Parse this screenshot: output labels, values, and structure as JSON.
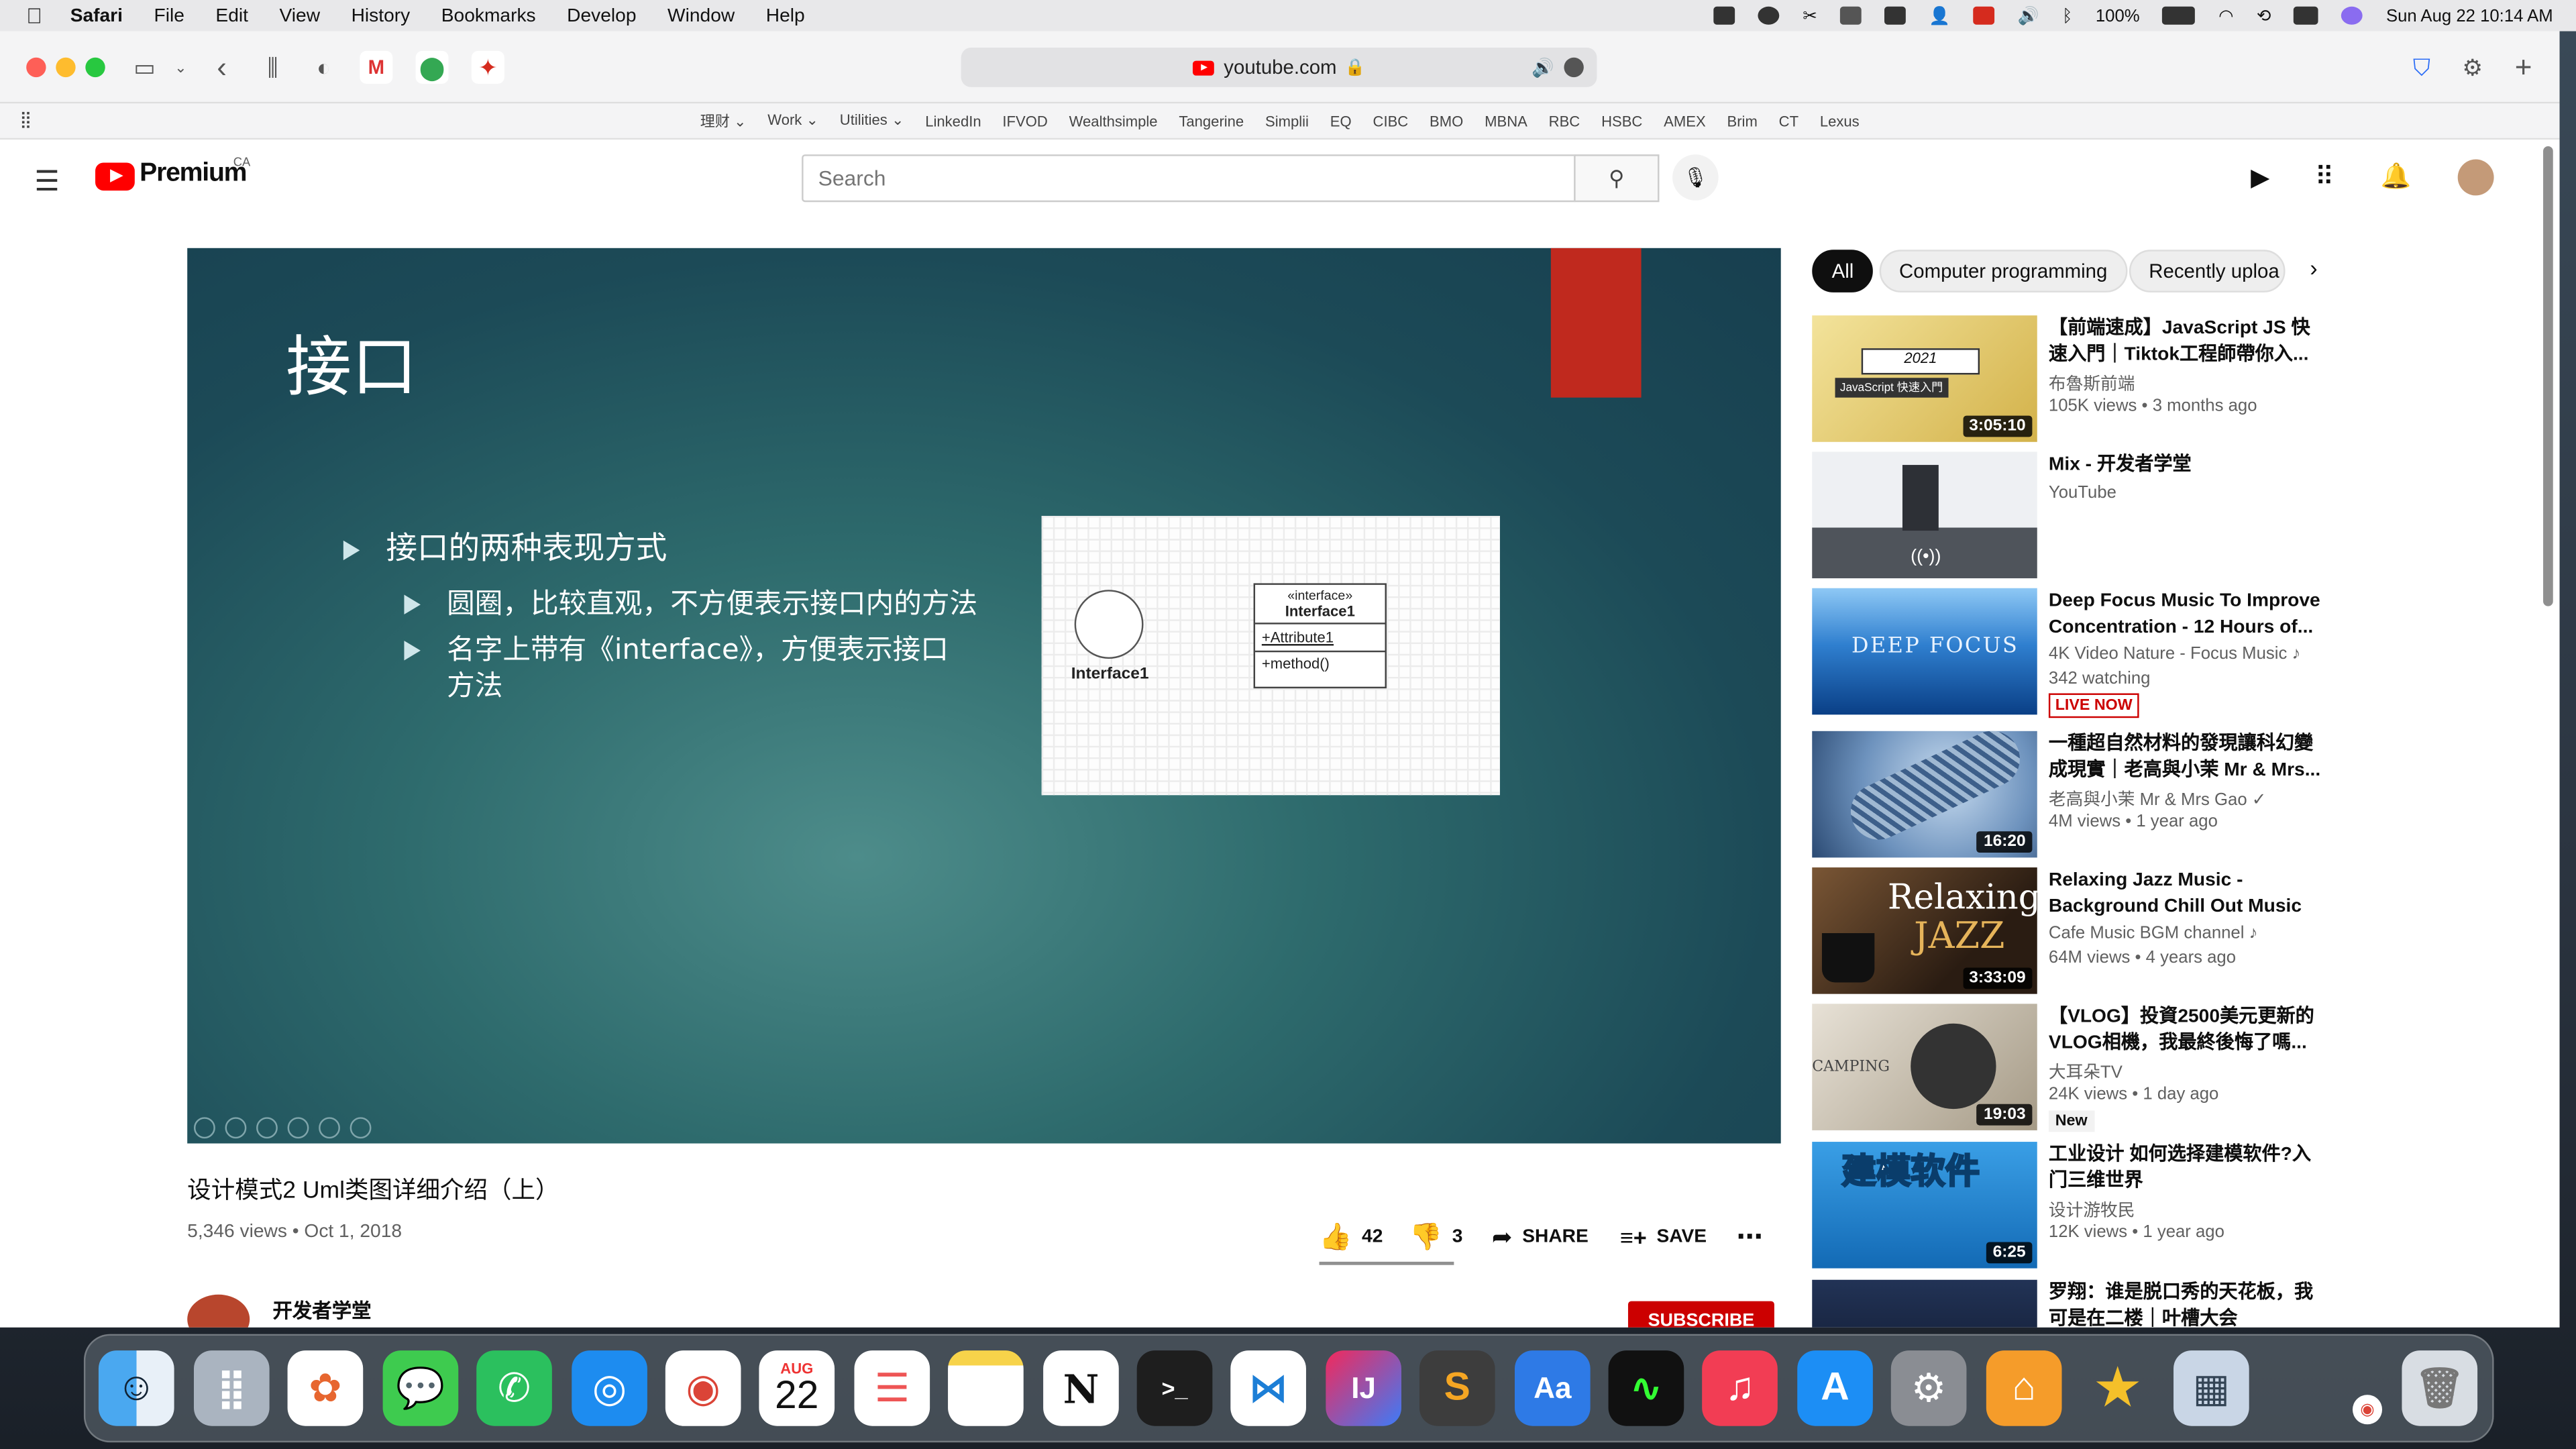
{
  "menubar": {
    "app": "Safari",
    "items": [
      "File",
      "Edit",
      "View",
      "History",
      "Bookmarks",
      "Develop",
      "Window",
      "Help"
    ],
    "battery": "100%",
    "datetime": "Sun Aug 22  10:14 AM"
  },
  "safari": {
    "address": "youtube.com",
    "bookmarks": [
      "理财 ⌄",
      "Work ⌄",
      "Utilities ⌄",
      "LinkedIn",
      "IFVOD",
      "Wealthsimple",
      "Tangerine",
      "Simplii",
      "EQ",
      "CIBC",
      "BMO",
      "MBNA",
      "RBC",
      "HSBC",
      "AMEX",
      "Brim",
      "CT",
      "Lexus"
    ]
  },
  "youtube": {
    "logo": "Premium",
    "region": "CA",
    "search_placeholder": "Search"
  },
  "slide": {
    "title": "接口",
    "bullet_main": "接口的两种表现方式",
    "bullet_sub1": "圆圈，比较直观，不方便表示接口内的方法",
    "bullet_sub2_l1": "名字上带有《interface》，方便表示接口",
    "bullet_sub2_l2": "方法",
    "uml": {
      "circle_label": "Interface1",
      "stereotype": "«interface»",
      "class_name": "Interface1",
      "attribute": "+Attribute1",
      "method": "+method()"
    }
  },
  "video": {
    "title": "设计模式2 Uml类图详细介绍（上）",
    "meta": "5,346 views • Oct 1, 2018",
    "likes": "42",
    "dislikes": "3",
    "share": "SHARE",
    "save": "SAVE",
    "channel": "开发者学堂",
    "subscribe": "SUBSCRIBE"
  },
  "chips": [
    "All",
    "Computer programming",
    "Recently uploa"
  ],
  "recs": [
    {
      "title": "【前端速成】JavaScript JS 快速入門｜Tiktok工程師帶你入...",
      "channel": "布魯斯前端",
      "meta": "105K views • 3 months ago",
      "duration": "3:05:10",
      "thumb_text": "2021",
      "thumb_text2": "JavaScript 快速入門",
      "colors": [
        "#e8d17a",
        "#c9a83a"
      ]
    },
    {
      "title": "Mix - 开发者学堂",
      "channel": "YouTube",
      "meta": "",
      "duration": "",
      "colors": [
        "#dfe3e8",
        "#5a6068"
      ]
    },
    {
      "title": "Deep Focus Music To Improve Concentration - 12 Hours of...",
      "channel": "4K Video Nature - Focus Music ♪",
      "meta": "342 watching",
      "live": "LIVE NOW",
      "duration": "",
      "thumb_text": "DEEP FOCUS",
      "colors": [
        "#3f8fd6",
        "#0b3f7a"
      ]
    },
    {
      "title": "一種超自然材料的發現讓科幻變成現實｜老高與小茉 Mr & Mrs...",
      "channel": "老高與小茉 Mr & Mrs Gao ✓",
      "meta": "4M views • 1 year ago",
      "duration": "16:20",
      "colors": [
        "#8fb4d9",
        "#2d4f7a"
      ]
    },
    {
      "title": "Relaxing Jazz Music - Background Chill Out Music -...",
      "channel": "Cafe Music BGM channel ♪",
      "meta": "64M views • 4 years ago",
      "duration": "3:33:09",
      "thumb_text": "Relaxing",
      "thumb_text2": "JAZZ",
      "colors": [
        "#6b4a2a",
        "#1a1410"
      ]
    },
    {
      "title": "【VLOG】投資2500美元更新的VLOG相機，我最終後悔了嗎...",
      "channel": "大耳朵TV",
      "meta": "24K views • 1 day ago",
      "badge": "New",
      "duration": "19:03",
      "thumb_text": "CAMPING",
      "colors": [
        "#d8d2c6",
        "#5a5246"
      ]
    },
    {
      "title": "工业设计 如何选择建模软件?入门三维世界",
      "channel": "设计游牧民",
      "meta": "12K views • 1 year ago",
      "duration": "6:25",
      "thumb_text": "建模软件",
      "colors": [
        "#2a8fd6",
        "#155a9c"
      ]
    },
    {
      "title": "罗翔：谁是脱口秀的天花板，我可是在二楼｜叶槽大会",
      "channel": "",
      "meta": "",
      "duration": "",
      "colors": [
        "#1d2a4a",
        "#0c1326"
      ]
    }
  ],
  "dock": {
    "calendar_month": "AUG",
    "calendar_day": "22",
    "apps": [
      "Finder",
      "Launchpad",
      "Photos",
      "Messages",
      "WeChat",
      "Safari",
      "Chrome",
      "Calendar",
      "Reminders",
      "Notes",
      "Notion",
      "Terminal",
      "VS Code",
      "IntelliJ IDEA",
      "Sublime Text",
      "Dictionary",
      "Activity Monitor",
      "Music",
      "App Store",
      "System Preferences",
      "Home",
      "Instruments",
      "Preview",
      "Trash"
    ]
  }
}
